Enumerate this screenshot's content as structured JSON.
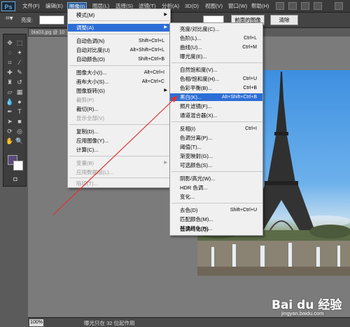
{
  "app": {
    "logo": "Ps"
  },
  "menubar": {
    "items": [
      "文件(F)",
      "编辑(E)",
      "图像(I)",
      "图层(L)",
      "选择(S)",
      "滤镜(T)",
      "分析(A)",
      "3D(D)",
      "视图(V)",
      "窗口(W)",
      "帮助(H)"
    ],
    "active": "图像(I)"
  },
  "options": {
    "height_label": "亮度:",
    "front_image_button": "前面的图像",
    "clear_button": "清除"
  },
  "document": {
    "tab_title": "bla03.jpg @ 10"
  },
  "status": {
    "zoom": "100%",
    "text": "曝光只在 32 位起作用"
  },
  "colors": {
    "accent": "#2d6ed6",
    "foreground": "#5a4a7a",
    "background": "#ffffff",
    "annotation": "#e03030"
  },
  "image_menu": {
    "items": [
      {
        "label": "模式(M)",
        "shortcut": "",
        "submenu": true
      },
      {
        "label": "调整(A)",
        "shortcut": "",
        "submenu": true,
        "highlighted": true
      },
      {
        "label": "自动色调(N)",
        "shortcut": "Shift+Ctrl+L"
      },
      {
        "label": "自动对比度(U)",
        "shortcut": "Alt+Shift+Ctrl+L"
      },
      {
        "label": "自动颜色(O)",
        "shortcut": "Shift+Ctrl+B"
      },
      {
        "label": "图像大小(I)...",
        "shortcut": "Alt+Ctrl+I"
      },
      {
        "label": "画布大小(S)...",
        "shortcut": "Alt+Ctrl+C"
      },
      {
        "label": "图像旋转(G)",
        "shortcut": "",
        "submenu": true
      },
      {
        "label": "裁剪(P)",
        "shortcut": "",
        "disabled": true
      },
      {
        "label": "裁切(R)...",
        "shortcut": ""
      },
      {
        "label": "显示全部(V)",
        "shortcut": "",
        "disabled": true
      },
      {
        "label": "复制(D)...",
        "shortcut": ""
      },
      {
        "label": "应用图像(Y)...",
        "shortcut": ""
      },
      {
        "label": "计算(C)...",
        "shortcut": ""
      },
      {
        "label": "变量(B)",
        "shortcut": "",
        "submenu": true,
        "disabled": true
      },
      {
        "label": "应用数据组(L)...",
        "shortcut": "",
        "disabled": true
      },
      {
        "label": "陷印(T)...",
        "shortcut": "",
        "disabled": true
      }
    ]
  },
  "adjust_menu": {
    "items": [
      {
        "label": "亮度/对比度(C)...",
        "shortcut": ""
      },
      {
        "label": "色阶(L)...",
        "shortcut": "Ctrl+L"
      },
      {
        "label": "曲线(U)...",
        "shortcut": "Ctrl+M"
      },
      {
        "label": "曝光度(E)...",
        "shortcut": ""
      },
      {
        "label": "自然饱和度(V)...",
        "shortcut": ""
      },
      {
        "label": "色相/饱和度(H)...",
        "shortcut": "Ctrl+U"
      },
      {
        "label": "色彩平衡(B)...",
        "shortcut": "Ctrl+B"
      },
      {
        "label": "黑白(K)...",
        "shortcut": "Alt+Shift+Ctrl+B",
        "highlighted": true
      },
      {
        "label": "照片滤镜(F)...",
        "shortcut": ""
      },
      {
        "label": "通道混合器(X)...",
        "shortcut": ""
      },
      {
        "label": "反相(I)",
        "shortcut": "Ctrl+I"
      },
      {
        "label": "色调分离(P)...",
        "shortcut": ""
      },
      {
        "label": "阈值(T)...",
        "shortcut": ""
      },
      {
        "label": "渐变映射(G)...",
        "shortcut": ""
      },
      {
        "label": "可选颜色(S)...",
        "shortcut": ""
      },
      {
        "label": "阴影/高光(W)...",
        "shortcut": ""
      },
      {
        "label": "HDR 色调...",
        "shortcut": ""
      },
      {
        "label": "变化...",
        "shortcut": ""
      },
      {
        "label": "去色(D)",
        "shortcut": "Shift+Ctrl+U"
      },
      {
        "label": "匹配颜色(M)...",
        "shortcut": ""
      },
      {
        "label": "替换颜色(R)...",
        "shortcut": ""
      },
      {
        "label": "色调均化(Q)",
        "shortcut": ""
      }
    ]
  },
  "watermark": {
    "brand": "Bai du 经验",
    "sub": "jingyan.baidu.com"
  }
}
